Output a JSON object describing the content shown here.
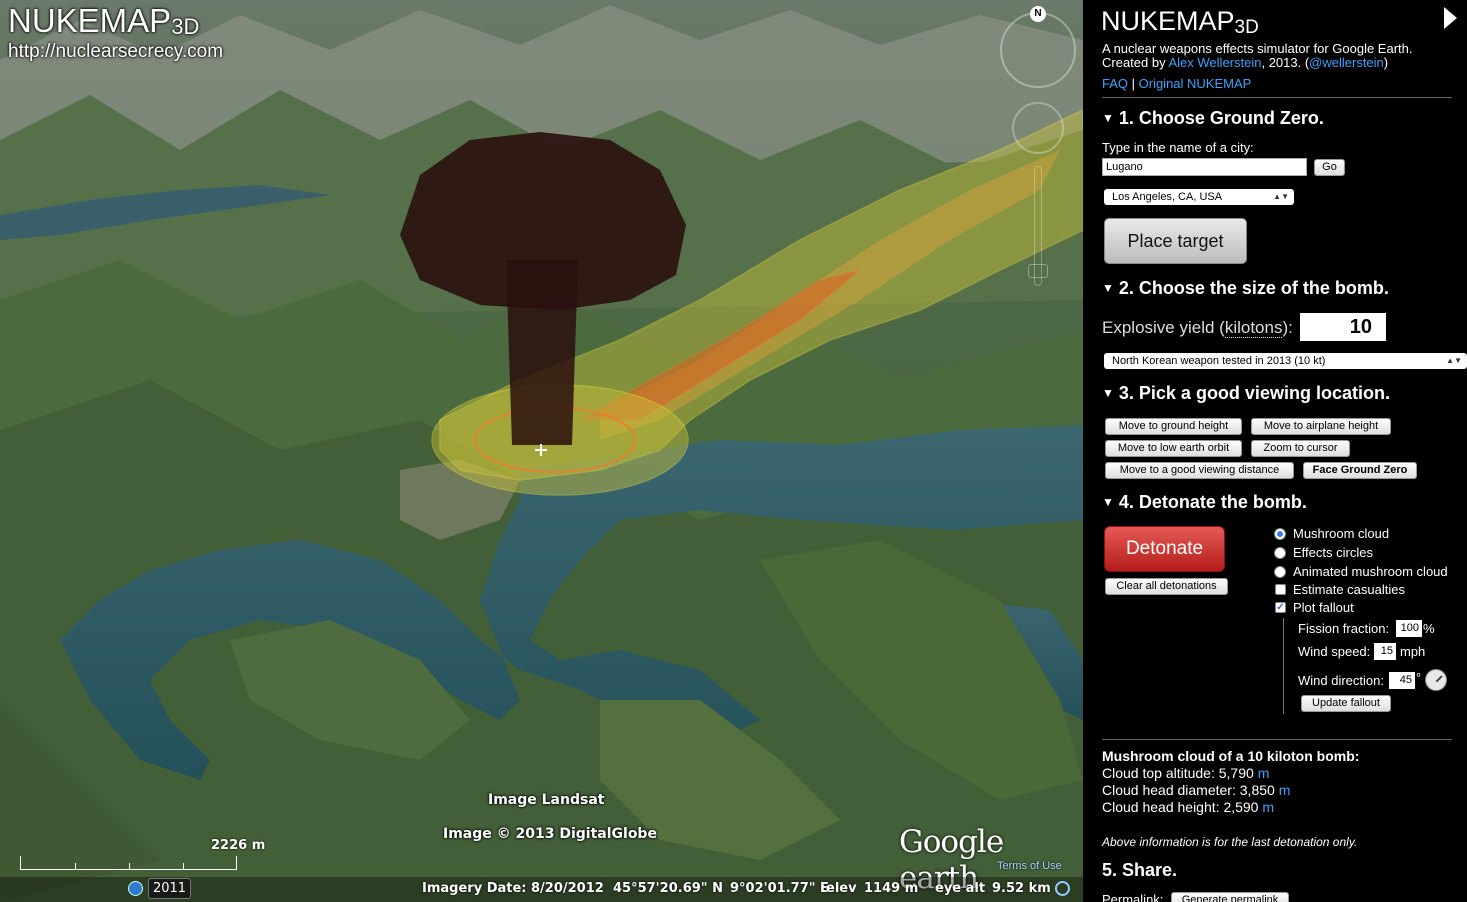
{
  "map": {
    "logo_title": "NUKEMAP",
    "logo_sub": "3D",
    "logo_url": "http://nuclearsecrecy.com",
    "credit_landsat": "Image Landsat",
    "credit_copyright": "Image © 2013 DigitalGlobe",
    "google_earth": "Google earth",
    "terms": "Terms of Use",
    "scale_label": "2226 m",
    "year": "2011",
    "compass_n": "N",
    "imagery_date": "Imagery Date: 8/20/2012",
    "lat": "45°57'20.69\" N",
    "lon": "9°02'01.77\" E",
    "elev_label": "elev",
    "elev": "1149 m",
    "eye_label": "eye alt",
    "eye_alt": "9.52 km",
    "colors": {
      "cloud": "#2a0f0d",
      "fallout_yellow": "#c9c23a",
      "fallout_orange": "#e05a1f",
      "lake": "#2f5a66"
    }
  },
  "panel": {
    "title": "NUKEMAP",
    "title_sub": "3D",
    "tagline": "A nuclear weapons effects simulator for Google Earth.",
    "created_by": "Created by ",
    "author": "Alex Wellerstein",
    "year_text": ", 2013. (",
    "twitter": "@wellerstein",
    "close_paren": ")",
    "faq": "FAQ",
    "sep": " | ",
    "original": "Original NUKEMAP",
    "sec1": "1. Choose Ground Zero.",
    "city_prompt": "Type in the name of a city:",
    "city_value": "Lugano",
    "go": "Go",
    "preset_city": "Los Angeles, CA, USA",
    "place_target": "Place target",
    "sec2": "2. Choose the size of the bomb.",
    "yield_label": "Explosive yield (",
    "yield_unit": "kilotons",
    "yield_end": "):",
    "yield_value": "10",
    "preset_weapon": "North Korean weapon tested in 2013 (10 kt)",
    "sec3": "3. Pick a good viewing location.",
    "view_buttons": [
      "Move to ground height",
      "Move to airplane height",
      "Move to low earth orbit",
      "Zoom to cursor",
      "Move to a good viewing distance",
      "Face Ground Zero"
    ],
    "sec4": "4. Detonate the bomb.",
    "detonate": "Detonate",
    "clear": "Clear all detonations",
    "options": [
      "Mushroom cloud",
      "Effects circles",
      "Animated mushroom cloud",
      "Estimate casualties",
      "Plot fallout"
    ],
    "fission_label": "Fission fraction:",
    "fission_value": "100",
    "fission_unit": "%",
    "wind_speed_label": "Wind speed:",
    "wind_speed_value": "15",
    "wind_speed_unit": "mph",
    "wind_dir_label": "Wind direction:",
    "wind_dir_value": "45",
    "wind_dir_unit": "°",
    "update_fallout": "Update fallout",
    "result_title": "Mushroom cloud of a 10 kiloton bomb:",
    "r1_label": "Cloud top altitude: ",
    "r1_value": "5,790",
    "r2_label": "Cloud head diameter: ",
    "r2_value": "3,850",
    "r3_label": "Cloud head height: ",
    "r3_value": "2,590",
    "unit_m": "m",
    "note": "Above information is for the last detonation only.",
    "sec5": "5. Share.",
    "permalink_label": "Permalink:",
    "permalink_btn": "Generate permalink"
  }
}
